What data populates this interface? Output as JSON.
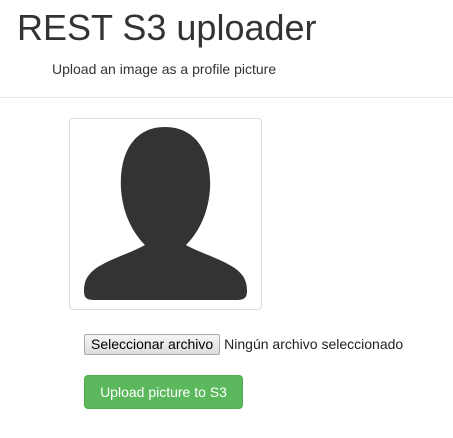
{
  "header": {
    "title": "REST S3 uploader",
    "subtitle": "Upload an image as a profile picture"
  },
  "avatar": {
    "icon": "user-silhouette-icon",
    "color": "#333333"
  },
  "file_input": {
    "button_label": "Seleccionar archivo",
    "status_text": "Ningún archivo seleccionado"
  },
  "upload": {
    "label": "Upload picture to S3",
    "color": "#5cb85c"
  }
}
